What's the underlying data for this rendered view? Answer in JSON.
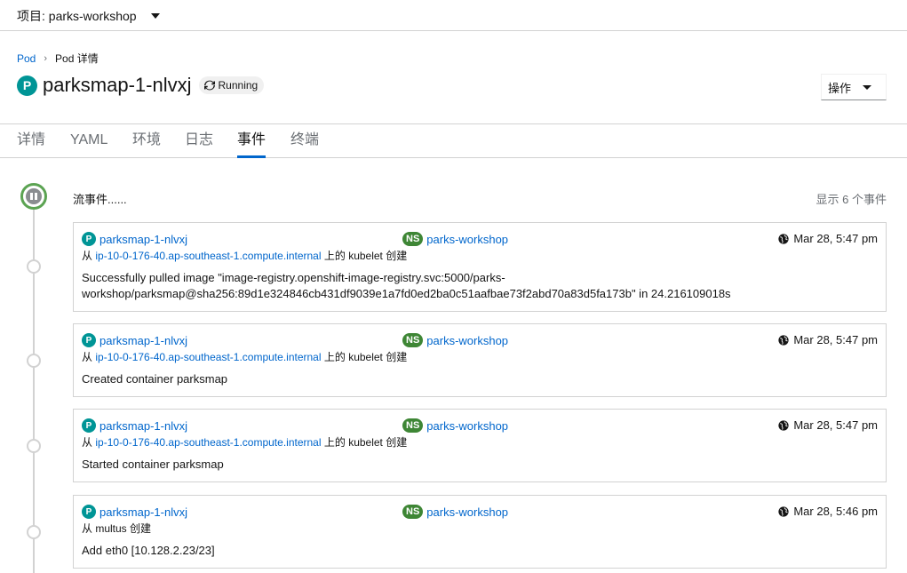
{
  "project": {
    "label": "项目: parks-workshop"
  },
  "breadcrumb": {
    "parent": "Pod",
    "current": "Pod 详情"
  },
  "pod": {
    "badge": "P",
    "name": "parksmap-1-nlvxj",
    "status": "Running"
  },
  "actions": {
    "label": "操作"
  },
  "tabs": [
    "详情",
    "YAML",
    "环境",
    "日志",
    "事件",
    "终端"
  ],
  "events_header": {
    "stream": "流事件......",
    "count": "显示 6 个事件"
  },
  "events": [
    {
      "pod": "parksmap-1-nlvxj",
      "ns_badge": "NS",
      "namespace": "parks-workshop",
      "time": "Mar 28, 5:47 pm",
      "source_prefix": "从",
      "source_node": "ip-10-0-176-40.ap-southeast-1.compute.internal",
      "source_suffix": "上的 kubelet 创建",
      "message": "Successfully pulled image \"image-registry.openshift-image-registry.svc:5000/parks-workshop/parksmap@sha256:89d1e324846cb431df9039e1a7fd0ed2ba0c51aafbae73f2abd70a83d5fa173b\" in 24.216109018s"
    },
    {
      "pod": "parksmap-1-nlvxj",
      "ns_badge": "NS",
      "namespace": "parks-workshop",
      "time": "Mar 28, 5:47 pm",
      "source_prefix": "从",
      "source_node": "ip-10-0-176-40.ap-southeast-1.compute.internal",
      "source_suffix": "上的 kubelet 创建",
      "message": "Created container parksmap"
    },
    {
      "pod": "parksmap-1-nlvxj",
      "ns_badge": "NS",
      "namespace": "parks-workshop",
      "time": "Mar 28, 5:47 pm",
      "source_prefix": "从",
      "source_node": "ip-10-0-176-40.ap-southeast-1.compute.internal",
      "source_suffix": "上的 kubelet 创建",
      "message": "Started container parksmap"
    },
    {
      "pod": "parksmap-1-nlvxj",
      "ns_badge": "NS",
      "namespace": "parks-workshop",
      "time": "Mar 28, 5:46 pm",
      "source_prefix": "从 multus 创建",
      "source_node": "",
      "source_suffix": "",
      "message": "Add eth0 [10.128.2.23/23]"
    }
  ],
  "colors": {
    "link": "#0066cc",
    "pod_badge": "#009596",
    "ns_badge": "#3e8635",
    "active_tab": "#0066cc",
    "stream_ring": "#5ba352"
  }
}
